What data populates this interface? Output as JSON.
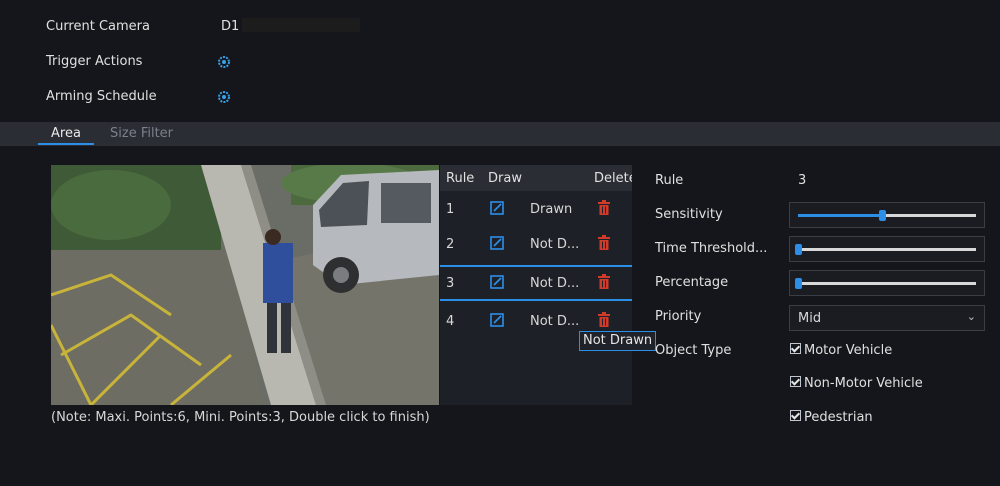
{
  "fields": {
    "current_camera_label": "Current Camera",
    "current_camera_value": "D1",
    "trigger_actions_label": "Trigger Actions",
    "arming_schedule_label": "Arming Schedule"
  },
  "tabs": [
    {
      "label": "Area",
      "active": true
    },
    {
      "label": "Size Filter",
      "active": false
    }
  ],
  "rules_table": {
    "headers": [
      "Rule",
      "Draw",
      "Delete"
    ],
    "rows": [
      {
        "rule": "1",
        "status": "Drawn"
      },
      {
        "rule": "2",
        "status": "Not D..."
      },
      {
        "rule": "3",
        "status": "Not D...",
        "selected": true
      },
      {
        "rule": "4",
        "status": "Not D..."
      }
    ],
    "tooltip": "Not Drawn"
  },
  "params": {
    "rule_label": "Rule",
    "rule_value": "3",
    "sensitivity_label": "Sensitivity",
    "sensitivity_level": 0.47,
    "time_threshold_label": "Time Threshold...",
    "time_threshold_level": 0.0,
    "percentage_label": "Percentage",
    "percentage_level": 0.0,
    "priority_label": "Priority",
    "priority_value": "Mid",
    "object_type_label": "Object Type",
    "object_types": [
      {
        "label": "Motor Vehicle",
        "checked": true
      },
      {
        "label": "Non-Motor Vehicle",
        "checked": true
      },
      {
        "label": "Pedestrian",
        "checked": true
      }
    ]
  },
  "note": "(Note: Maxi. Points:6, Mini. Points:3, Double click to finish)",
  "colors": {
    "accent": "#2d8ee8",
    "delete": "#d23a2a",
    "background": "#14161b"
  }
}
